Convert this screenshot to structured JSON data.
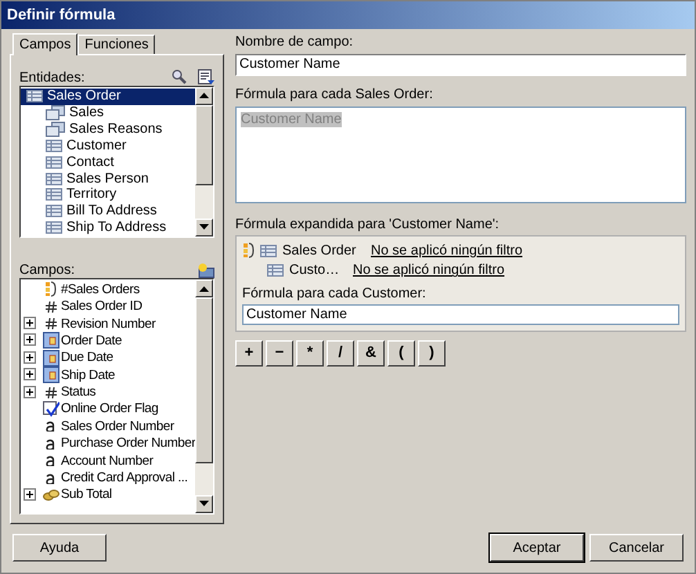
{
  "window": {
    "title": "Definir fórmula"
  },
  "tabs": [
    {
      "label": "Campos",
      "selected": true
    },
    {
      "label": "Funciones",
      "selected": false
    }
  ],
  "entities": {
    "label": "Entidades:",
    "items": [
      {
        "name": "Sales Order",
        "kind": "entity",
        "selected": true
      },
      {
        "name": "Sales",
        "kind": "collection",
        "selected": false
      },
      {
        "name": "Sales Reasons",
        "kind": "collection",
        "selected": false
      },
      {
        "name": "Customer",
        "kind": "entity",
        "selected": false
      },
      {
        "name": "Contact",
        "kind": "entity",
        "selected": false
      },
      {
        "name": "Sales Person",
        "kind": "entity",
        "selected": false
      },
      {
        "name": "Territory",
        "kind": "entity",
        "selected": false
      },
      {
        "name": "Bill To Address",
        "kind": "entity",
        "selected": false
      },
      {
        "name": "Ship To Address",
        "kind": "entity",
        "selected": false
      }
    ]
  },
  "fields": {
    "label": "Campos:",
    "items": [
      {
        "name": "#Sales Orders",
        "kind": "count",
        "expandable": false
      },
      {
        "name": "Sales Order ID",
        "kind": "number",
        "expandable": false
      },
      {
        "name": "Revision Number",
        "kind": "number",
        "expandable": true
      },
      {
        "name": "Order Date",
        "kind": "date",
        "expandable": true
      },
      {
        "name": "Due Date",
        "kind": "date",
        "expandable": true
      },
      {
        "name": "Ship Date",
        "kind": "date",
        "expandable": true
      },
      {
        "name": "Status",
        "kind": "number",
        "expandable": true
      },
      {
        "name": "Online Order Flag",
        "kind": "bool",
        "expandable": false
      },
      {
        "name": "Sales Order Number",
        "kind": "text",
        "expandable": false
      },
      {
        "name": "Purchase Order Number",
        "kind": "text",
        "expandable": false
      },
      {
        "name": "Account Number",
        "kind": "text",
        "expandable": false
      },
      {
        "name": "Credit Card Approval ...",
        "kind": "text",
        "expandable": false
      },
      {
        "name": "Sub Total",
        "kind": "currency",
        "expandable": true
      }
    ]
  },
  "field_name": {
    "label": "Nombre de campo:",
    "value": "Customer Name"
  },
  "formula": {
    "label": "Fórmula para cada Sales Order:",
    "value": "Customer Name"
  },
  "expanded": {
    "label": "Fórmula expandida para 'Customer Name':",
    "rows": [
      {
        "entity": "Sales Order",
        "filter": "No se aplicó ningún filtro",
        "kind": "root"
      },
      {
        "entity": "Custo…",
        "filter": "No se aplicó ningún filtro",
        "kind": "child"
      }
    ],
    "formula_label": "Fórmula para cada Customer:",
    "formula_value": "Customer Name"
  },
  "operators": [
    "+",
    "−",
    "*",
    "/",
    "&",
    "(",
    ")"
  ],
  "buttons": {
    "help": "Ayuda",
    "ok": "Aceptar",
    "cancel": "Cancelar"
  }
}
